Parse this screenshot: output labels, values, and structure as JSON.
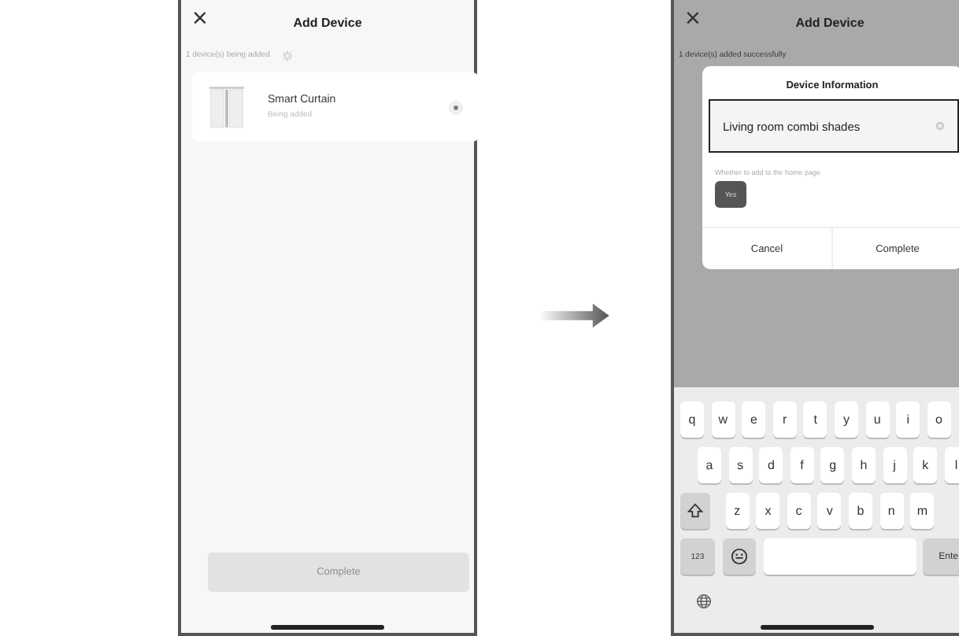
{
  "left_screen": {
    "header": {
      "close": "×",
      "title": "Add Device"
    },
    "status_text": "1 device(s) being added",
    "device": {
      "name": "Smart Curtain",
      "status": "Being added"
    },
    "complete_button": {
      "label": "Complete",
      "disabled": true
    }
  },
  "right_screen": {
    "header": {
      "close": "×",
      "title": "Add Device"
    },
    "status_text": "1 device(s) added successfully",
    "dialog": {
      "title": "Device Information",
      "name_field": {
        "value": "Living room combi shades"
      },
      "home_page_label": "Whether to add to the home page",
      "home_toggle": {
        "label": "Yes",
        "selected": true
      },
      "buttons": [
        "Cancel",
        "Complete"
      ]
    },
    "keyboard": {
      "rows": [
        [
          {
            "kind": "letter",
            "label": "q"
          },
          {
            "kind": "letter",
            "label": "w"
          },
          {
            "kind": "letter",
            "label": "e"
          },
          {
            "kind": "letter",
            "label": "r"
          },
          {
            "kind": "letter",
            "label": "t"
          },
          {
            "kind": "letter",
            "label": "y"
          },
          {
            "kind": "letter",
            "label": "u"
          },
          {
            "kind": "letter",
            "label": "i"
          },
          {
            "kind": "letter",
            "label": "o"
          }
        ],
        [
          {
            "kind": "letter",
            "label": "a"
          },
          {
            "kind": "letter",
            "label": "s"
          },
          {
            "kind": "letter",
            "label": "d"
          },
          {
            "kind": "letter",
            "label": "f"
          },
          {
            "kind": "letter",
            "label": "g"
          },
          {
            "kind": "letter",
            "label": "h"
          },
          {
            "kind": "letter",
            "label": "j"
          },
          {
            "kind": "letter",
            "label": "k"
          },
          {
            "kind": "letter",
            "label": "l"
          }
        ],
        [
          {
            "kind": "shift"
          },
          {
            "kind": "letter",
            "label": "z"
          },
          {
            "kind": "letter",
            "label": "x"
          },
          {
            "kind": "letter",
            "label": "c"
          },
          {
            "kind": "letter",
            "label": "v"
          },
          {
            "kind": "letter",
            "label": "b"
          },
          {
            "kind": "letter",
            "label": "n"
          },
          {
            "kind": "letter",
            "label": "m"
          }
        ],
        [
          {
            "kind": "numbers",
            "label": "123"
          },
          {
            "kind": "emoji"
          },
          {
            "kind": "space"
          },
          {
            "kind": "enter",
            "label": "Ente"
          }
        ]
      ]
    }
  }
}
